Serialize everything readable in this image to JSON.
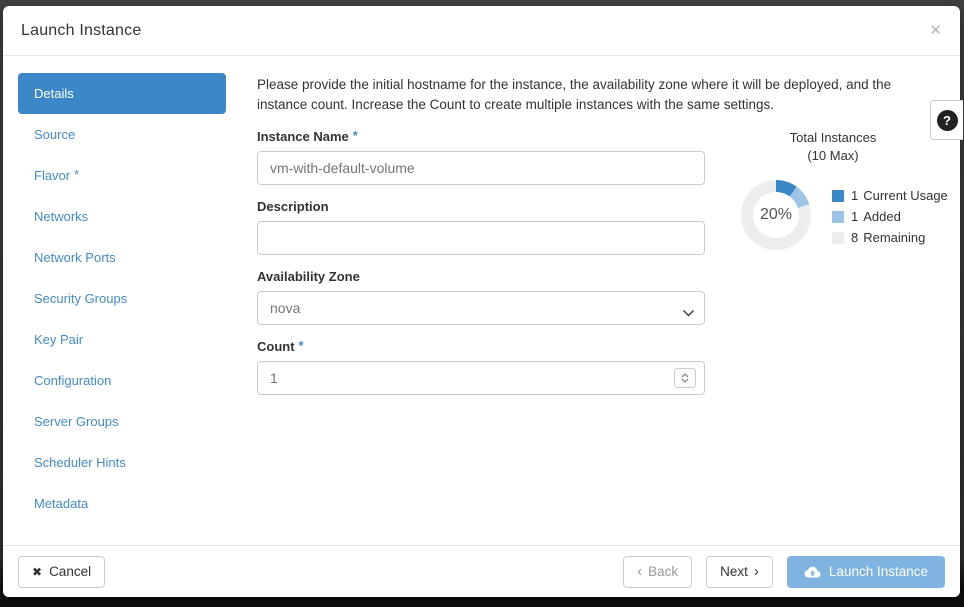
{
  "modal": {
    "title": "Launch Instance"
  },
  "icons": {
    "close": "✕",
    "cancel": "✖",
    "back_caret": "‹",
    "next_caret": "›",
    "help": "?"
  },
  "sidebar": {
    "items": [
      {
        "label": "Details",
        "active": true
      },
      {
        "label": "Source"
      },
      {
        "label": "Flavor",
        "required_mark": "*"
      },
      {
        "label": "Networks"
      },
      {
        "label": "Network Ports"
      },
      {
        "label": "Security Groups"
      },
      {
        "label": "Key Pair"
      },
      {
        "label": "Configuration"
      },
      {
        "label": "Server Groups"
      },
      {
        "label": "Scheduler Hints"
      },
      {
        "label": "Metadata"
      }
    ]
  },
  "form": {
    "intro": "Please provide the initial hostname for the instance, the availability zone where it will be deployed, and the instance count. Increase the Count to create multiple instances with the same settings.",
    "instance_name": {
      "label": "Instance Name",
      "required_mark": "*",
      "value": "vm-with-default-volume"
    },
    "description": {
      "label": "Description",
      "value": ""
    },
    "availability_zone": {
      "label": "Availability Zone",
      "value": "nova"
    },
    "count": {
      "label": "Count",
      "required_mark": "*",
      "value": "1"
    }
  },
  "chart_data": {
    "type": "pie",
    "title": "Total Instances",
    "subtitle": "(10 Max)",
    "center_label": "20%",
    "max": 10,
    "series": [
      {
        "name": "Current Usage",
        "value": 1,
        "color": "#3a87c8"
      },
      {
        "name": "Added",
        "value": 1,
        "color": "#9dc3e6"
      },
      {
        "name": "Remaining",
        "value": 8,
        "color": "#ededed"
      }
    ],
    "legend_position": "right"
  },
  "footer": {
    "cancel_label": "Cancel",
    "back_label": "Back",
    "next_label": "Next",
    "launch_label": "Launch Instance"
  }
}
